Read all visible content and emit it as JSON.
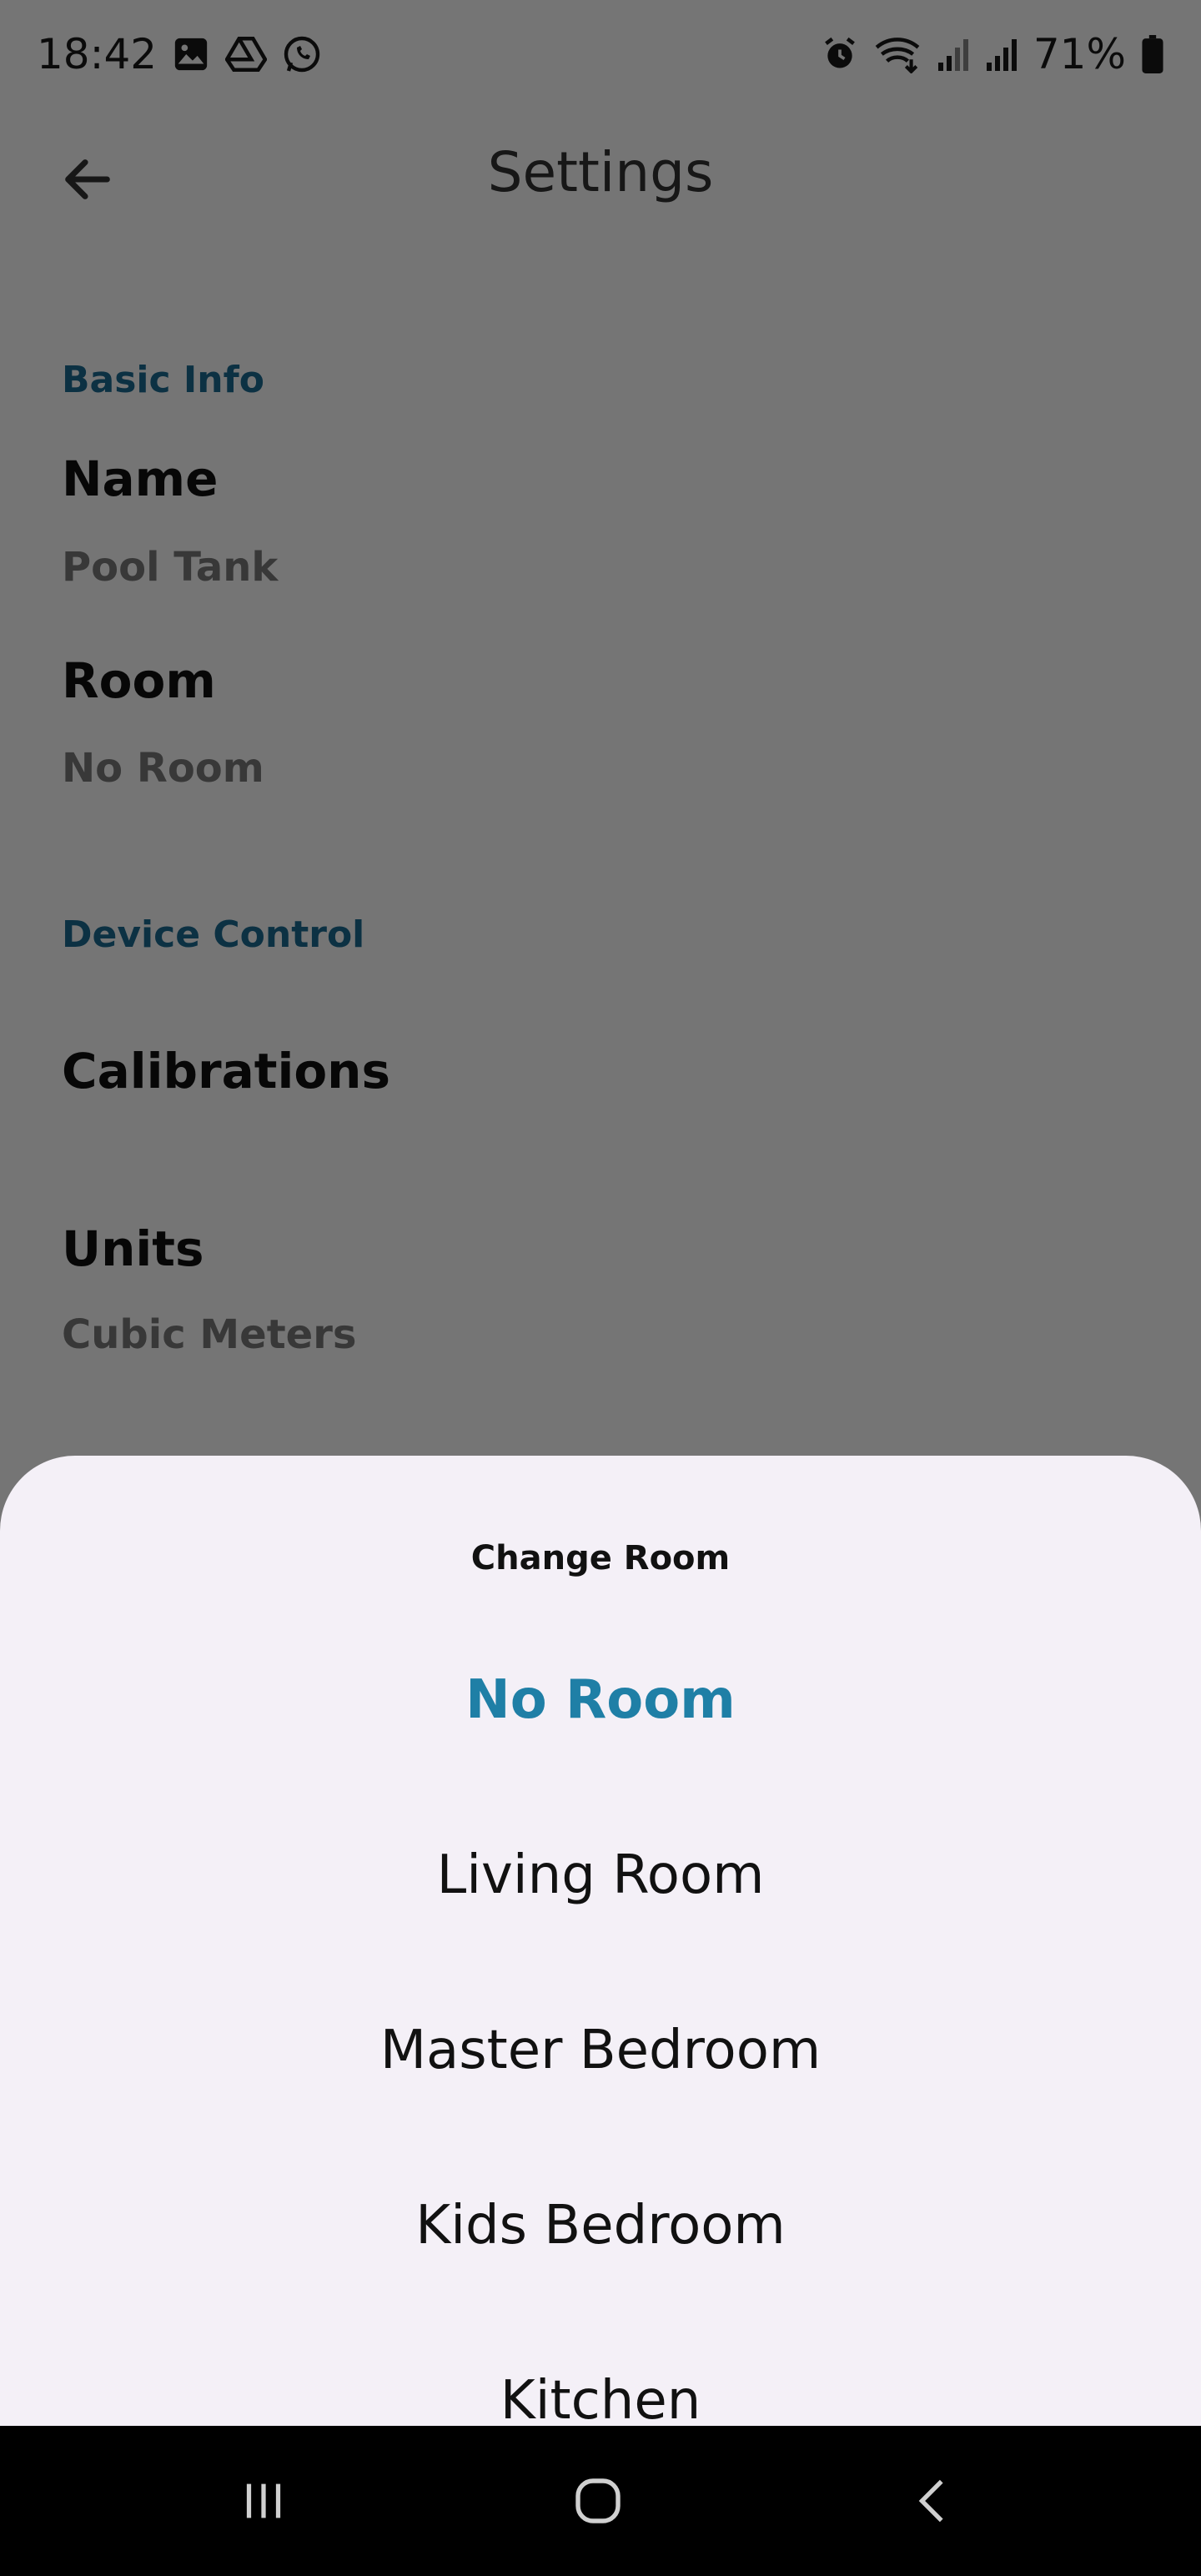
{
  "status_bar": {
    "time": "18:42",
    "battery": "71%",
    "left_icons": [
      "gallery-icon",
      "drive-icon",
      "whatsapp-icon"
    ],
    "right_icons": [
      "alarm-icon",
      "wifi-icon",
      "signal-icon",
      "signal-icon",
      "battery-icon"
    ]
  },
  "app_bar": {
    "title": "Settings",
    "back_icon": "arrow-left-icon"
  },
  "sections": {
    "basic_info": {
      "header": "Basic Info",
      "name": {
        "title": "Name",
        "value": "Pool Tank"
      },
      "room": {
        "title": "Room",
        "value": "No Room"
      }
    },
    "device_control": {
      "header": "Device Control",
      "calibrations": {
        "title": "Calibrations"
      },
      "units": {
        "title": "Units",
        "value": "Cubic Meters"
      }
    }
  },
  "sheet": {
    "title": "Change Room",
    "options": [
      "No Room",
      "Living Room",
      "Master Bedroom",
      "Kids Bedroom",
      "Kitchen"
    ],
    "selected": "No Room"
  },
  "colors": {
    "accent": "#1f7fa6",
    "section_header": "#1c6b93",
    "sheet_bg": "#f4f0f7",
    "scrim": "#7a7a7a"
  },
  "nav_bar": {
    "icons": [
      "recent-apps-icon",
      "home-icon",
      "back-icon"
    ]
  }
}
